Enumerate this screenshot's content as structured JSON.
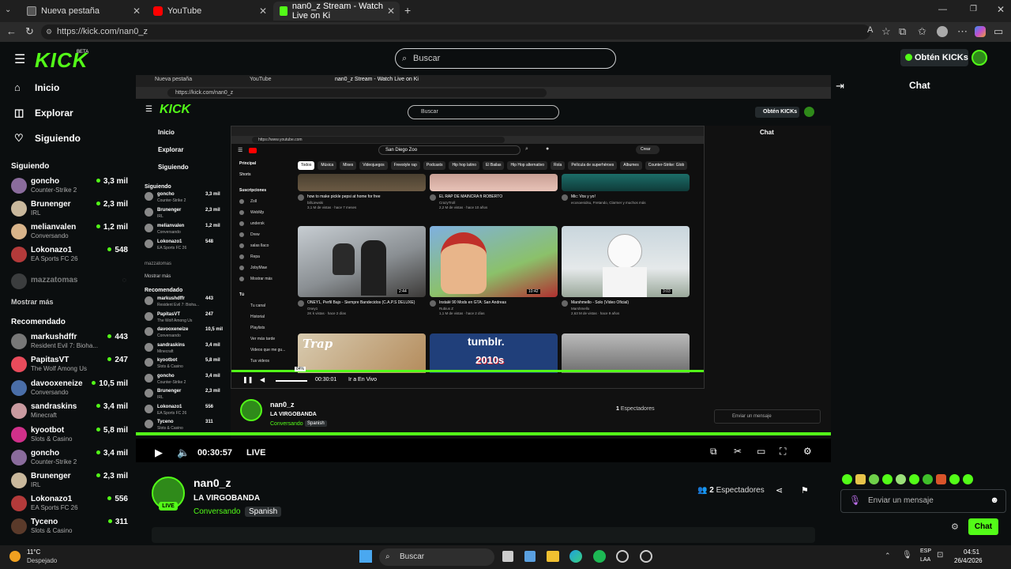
{
  "browser": {
    "tabs": [
      {
        "label": "Nueva pestaña"
      },
      {
        "label": "YouTube"
      },
      {
        "label": "nan0_z Stream - Watch Live on Ki"
      }
    ],
    "url": "https://kick.com/nan0_z"
  },
  "kick": {
    "logo": "KICK",
    "logo_badge": "BETA",
    "search_placeholder": "Buscar",
    "get_kicks": "Obtén KICKs",
    "nav": [
      {
        "label": "Inicio",
        "icon": "home-icon"
      },
      {
        "label": "Explorar",
        "icon": "compass-icon"
      },
      {
        "label": "Siguiendo",
        "icon": "heart-icon"
      }
    ],
    "following_title": "Siguiendo",
    "following": [
      {
        "name": "goncho",
        "category": "Counter-Strike 2",
        "viewers": "3,3 mil",
        "color": "#8a6c9c"
      },
      {
        "name": "Brunenger",
        "category": "IRL",
        "viewers": "2,3 mil",
        "color": "#c9b89c"
      },
      {
        "name": "melianvalen",
        "category": "Conversando",
        "viewers": "1,2 mil",
        "color": "#d8b48a"
      },
      {
        "name": "Lokonazo1",
        "category": "EA Sports FC 26",
        "viewers": "548",
        "color": "#b33a3a"
      }
    ],
    "offline_channel": "mazzatomas",
    "show_more": "Mostrar más",
    "recommended_title": "Recomendado",
    "recommended": [
      {
        "name": "markushdffr",
        "category": "Resident Evil 7: Bioha...",
        "viewers": "443",
        "color": "#777"
      },
      {
        "name": "PapitasVT",
        "category": "The Wolf Among Us",
        "viewers": "247",
        "color": "#e84b5b"
      },
      {
        "name": "davooxeneize",
        "category": "Conversando",
        "viewers": "10,5 mil",
        "color": "#4a6ea8"
      },
      {
        "name": "sandraskins",
        "category": "Minecraft",
        "viewers": "3,4 mil",
        "color": "#c99aa0"
      },
      {
        "name": "kyootbot",
        "category": "Slots & Casino",
        "viewers": "5,8 mil",
        "color": "#d0308a"
      },
      {
        "name": "goncho",
        "category": "Counter-Strike 2",
        "viewers": "3,4 mil",
        "color": "#8a6c9c"
      },
      {
        "name": "Brunenger",
        "category": "IRL",
        "viewers": "2,3 mil",
        "color": "#c9b89c"
      },
      {
        "name": "Lokonazo1",
        "category": "EA Sports FC 26",
        "viewers": "556",
        "color": "#b33a3a"
      },
      {
        "name": "Tyceno",
        "category": "Slots & Casino",
        "viewers": "311",
        "color": "#5a3a2a"
      }
    ],
    "chat_title": "Chat",
    "player": {
      "time": "00:30:57",
      "live": "LIVE",
      "progress": 1.0
    },
    "stream": {
      "channel": "nan0_z",
      "title": "LA VIRGOBANDA",
      "category": "Conversando",
      "tag": "Spanish",
      "live_badge": "LIVE",
      "viewers_count": "2",
      "viewers_label": "Espectadores"
    },
    "chat_input_placeholder": "Enviar un mensaje",
    "chat_button": "Chat"
  },
  "inner": {
    "url": "https://kick.com/nan0_z",
    "search_placeholder": "Buscar",
    "get_kicks": "Obtén KICKs",
    "chat_title": "Chat",
    "nav": [
      "Inicio",
      "Explorar",
      "Siguiendo"
    ],
    "following_title": "Siguiendo",
    "following": [
      {
        "name": "goncho",
        "category": "Counter-Strike 2",
        "viewers": "3,3 mil"
      },
      {
        "name": "Brunenger",
        "category": "IRL",
        "viewers": "2,3 mil"
      },
      {
        "name": "melianvalen",
        "category": "Conversando",
        "viewers": "1,2 mil"
      },
      {
        "name": "Lokonazo1",
        "category": "EA Sports FC 26",
        "viewers": "548"
      }
    ],
    "offline_channel": "mazzatomas",
    "show_more": "Mostrar más",
    "recommended_title": "Recomendado",
    "recommended": [
      {
        "name": "markushdffr",
        "category": "Resident Evil 7: Bioha...",
        "viewers": "443"
      },
      {
        "name": "PapitasVT",
        "category": "The Wolf Among Us",
        "viewers": "247"
      },
      {
        "name": "davooxeneize",
        "category": "Conversando",
        "viewers": "10,5 mil"
      },
      {
        "name": "sandraskins",
        "category": "Minecraft",
        "viewers": "3,4 mil"
      },
      {
        "name": "kyootbot",
        "category": "Slots & Casino",
        "viewers": "5,8 mil"
      },
      {
        "name": "goncho",
        "category": "Counter-Strike 2",
        "viewers": "3,4 mil"
      },
      {
        "name": "Brunenger",
        "category": "IRL",
        "viewers": "2,3 mil"
      },
      {
        "name": "Lokonazo1",
        "category": "EA Sports FC 26",
        "viewers": "556"
      },
      {
        "name": "Tyceno",
        "category": "Slots & Casino",
        "viewers": "311"
      }
    ],
    "player_time": "00:30:01",
    "go_live": "Ir a En Vivo",
    "stream_channel": "nan0_z",
    "stream_title": "LA VIRGOBANDA",
    "stream_category": "Conversando",
    "stream_tag": "Spanish",
    "viewers_count": "1",
    "viewers_label": "Espectadores",
    "chat_input_placeholder": "Enviar un mensaje"
  },
  "youtube": {
    "url": "https://www.youtube.com",
    "search_value": "San Diego Zoo",
    "create_label": "Crear",
    "sidebar": [
      "Principal",
      "Shorts"
    ],
    "subscriptions_title": "Suscripciones",
    "subscriptions": [
      "Zoll",
      "WebMp",
      "undersk",
      "Drew",
      "salas llaco",
      "Repa",
      "JobyMaw",
      "Mostrar más"
    ],
    "you_title": "Tú",
    "you_items": [
      "Tu canal",
      "Historial",
      "Playlists",
      "Ver más tarde",
      "Videos que me gu...",
      "Tus videos"
    ],
    "chips": [
      "Todos",
      "Música",
      "Mixes",
      "Videojuegos",
      "Freestyle rap",
      "Podcasts",
      "Hip hop latino",
      "El Bailas",
      "Hip Hop alternativo",
      "Rola",
      "Película de superhéroes",
      "Albumes",
      "Counter-Strike: Glob"
    ],
    "videos": [
      {
        "title": "how to make pickle pepsi at home for free",
        "channel": "billLiewski",
        "meta": "3,1 M de vistas · hace 7 meses"
      },
      {
        "title": "EL RAP DE MAINCRA ft ROBERTO",
        "channel": "CrazyTroll",
        "meta": "2,2 M de vistas · hace 10 años"
      },
      {
        "title": "Mic: Vos y yo!",
        "channel": "ecosoenidsu, Fretando, Clarmer y muchos más",
        "meta": ""
      },
      {
        "title": "ONEY1, Perfil Bajo - Siempre Bandecidos (C.A.P.S DELUXE)",
        "channel": "Oney1",
        "meta": "2K k vistas · hace 2 días",
        "duration": "2:44"
      },
      {
        "title": "Instalé 90 Mods en GTA: San Andreas",
        "channel": "Rubius Z",
        "meta": "1,1 M de vistas · hace 2 días",
        "duration": "10:42"
      },
      {
        "title": "Marshmello - Solo (Video Oficial)",
        "channel": "Marshmello",
        "meta": "2,63 M de vistas · hace 9 años",
        "duration": "3:03"
      }
    ],
    "thumb_labels": [
      "Trap",
      "tumblr.",
      "2010s"
    ],
    "volume_pct": "84%"
  },
  "taskbar": {
    "temperature": "11°C",
    "weather": "Despejado",
    "search": "Buscar",
    "lang_top": "ESP",
    "lang_bottom": "LAA",
    "time": "04:51",
    "date": "26/4/2026"
  }
}
